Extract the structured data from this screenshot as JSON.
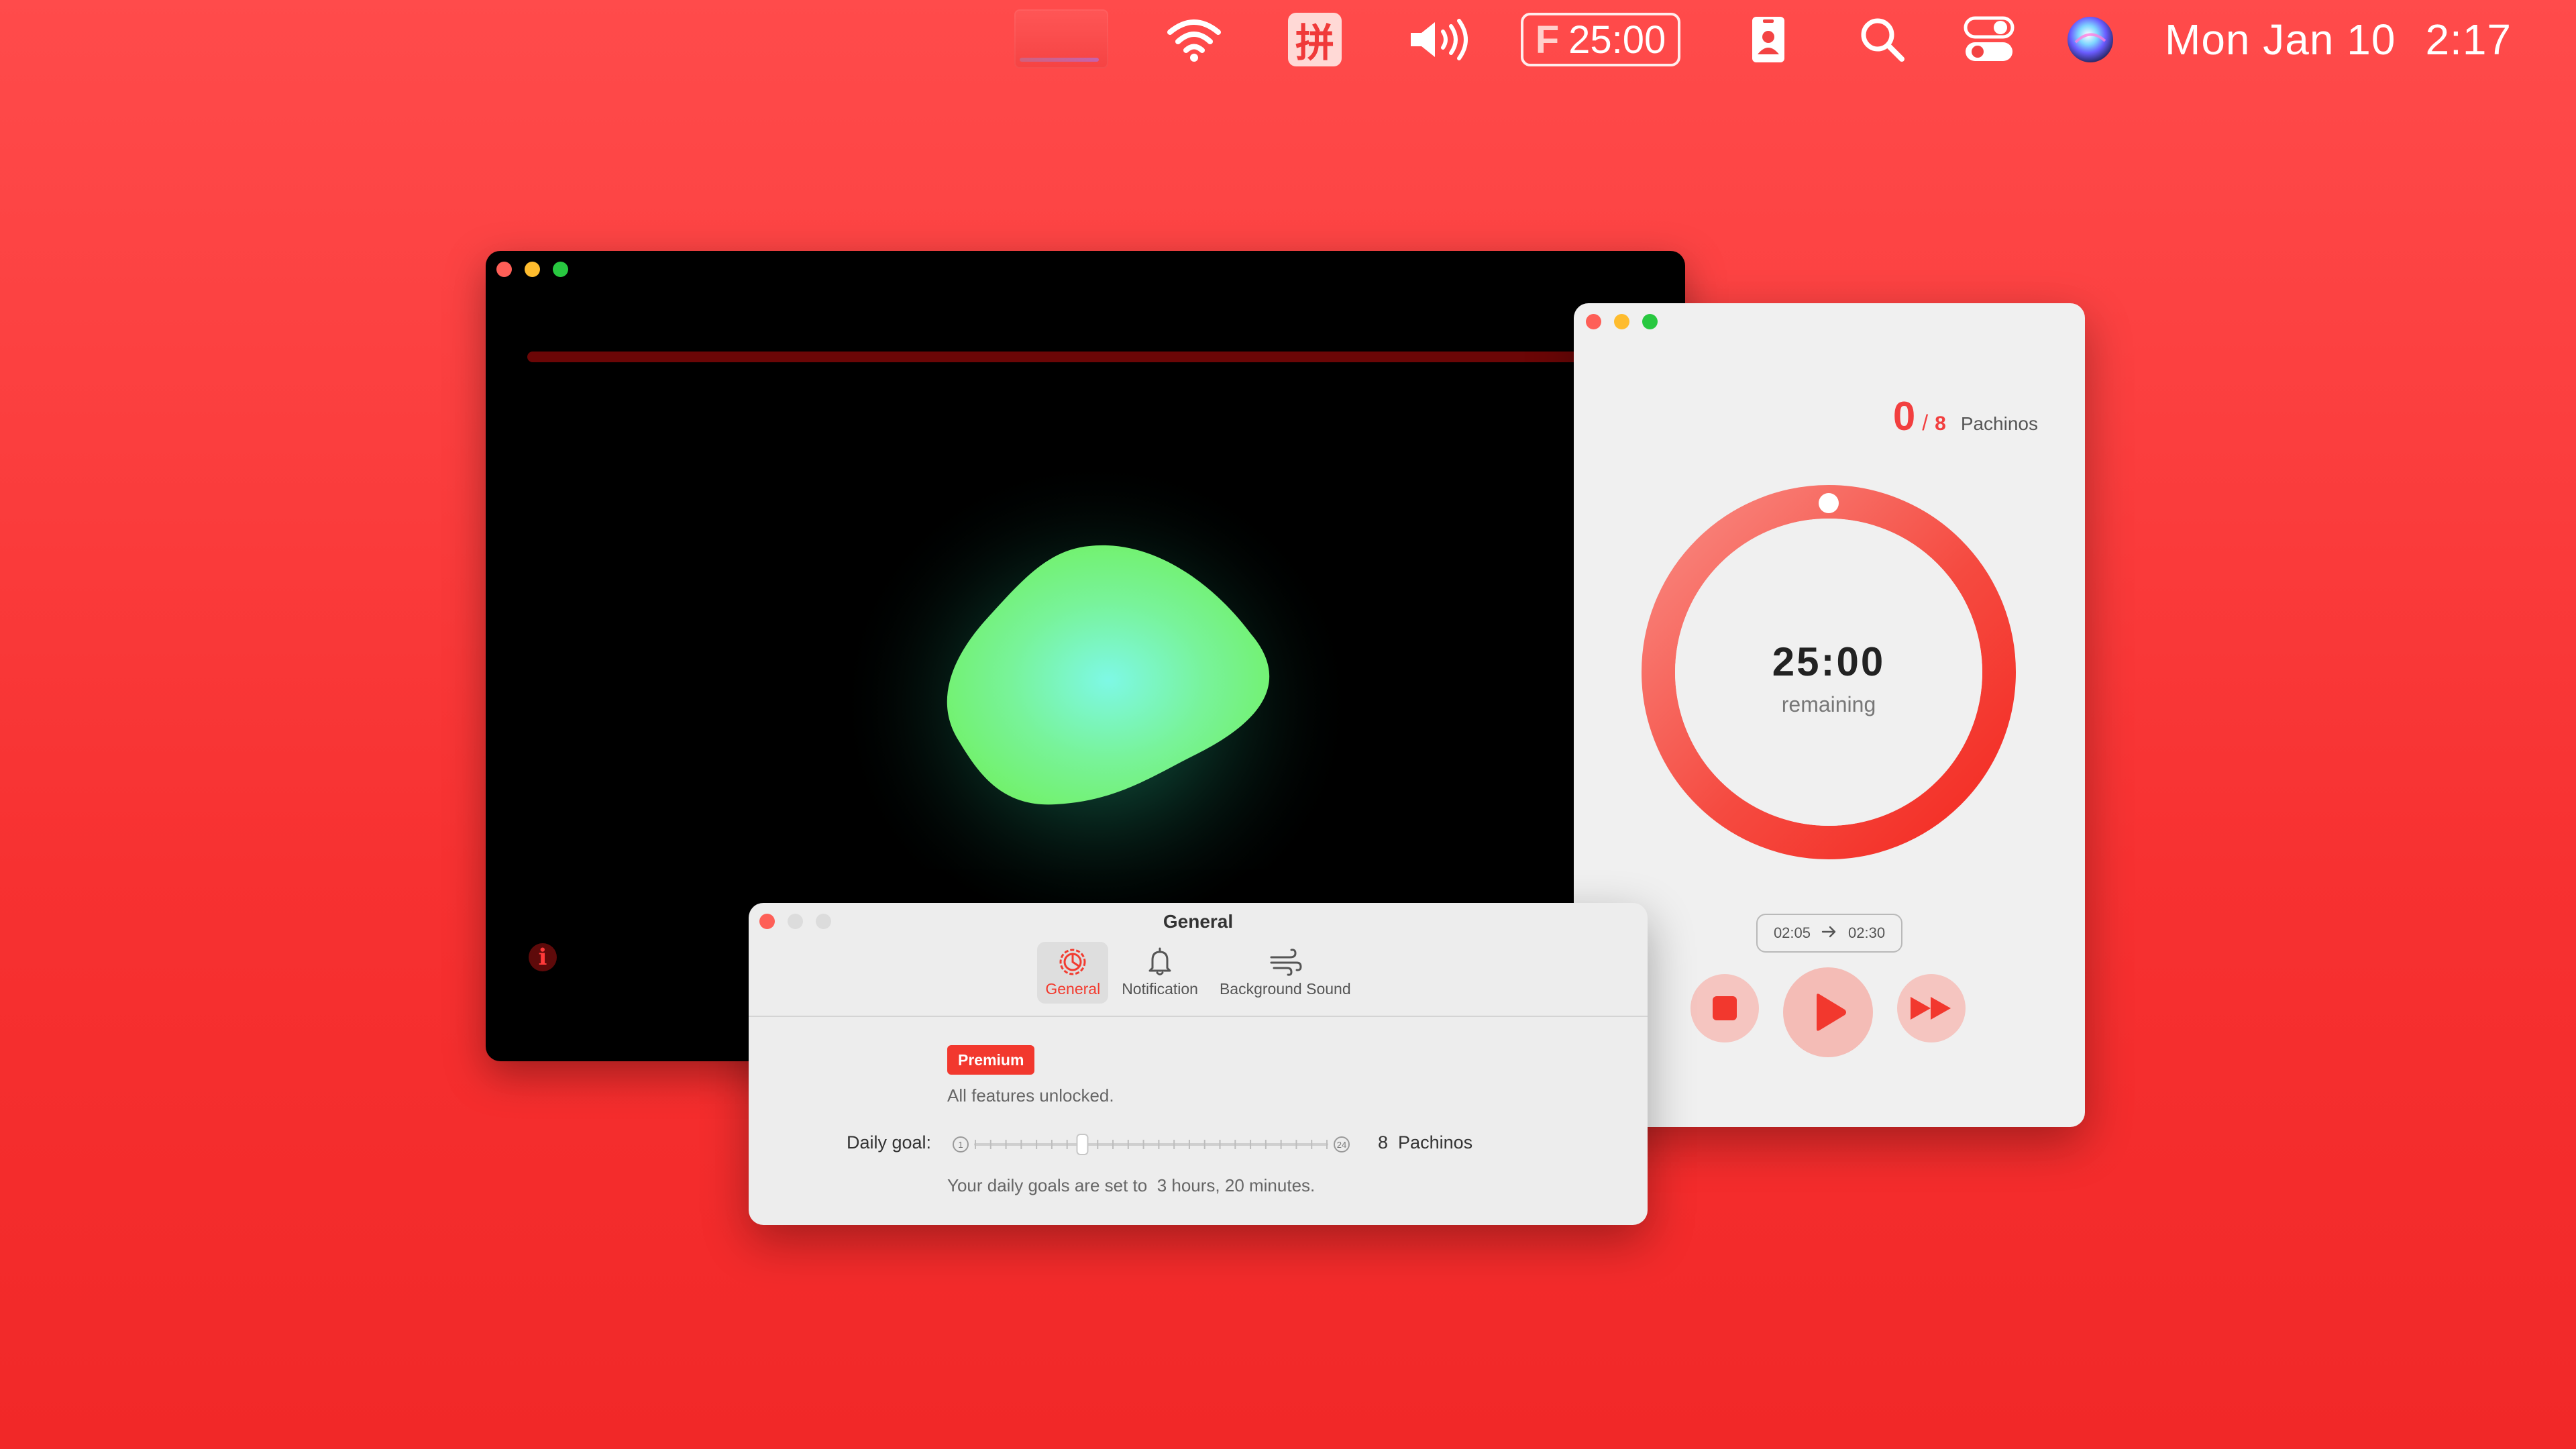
{
  "menubar": {
    "icons": [
      "screen-thumbnail",
      "wifi-icon",
      "pinyin-ime-icon",
      "volume-icon",
      "focus-timer",
      "contact-card-icon",
      "search-icon",
      "control-center-icon",
      "siri-icon"
    ],
    "ime_char": "拼",
    "timer_prefix": "F",
    "timer_value": "25:00",
    "date": "Mon Jan 10",
    "time": "2:17"
  },
  "timer_window": {
    "completed": "0",
    "separator": "/",
    "goal": "8",
    "unit": "Pachinos",
    "remaining_time": "25:00",
    "remaining_label": "remaining",
    "range_start": "02:05",
    "range_end": "02:30",
    "progress_fraction": 0,
    "accent": "#f23f3f"
  },
  "settings_window": {
    "title": "General",
    "tabs": [
      {
        "label": "General",
        "icon": "gear-icon",
        "active": true
      },
      {
        "label": "Notification",
        "icon": "bell-icon",
        "active": false
      },
      {
        "label": "Background Sound",
        "icon": "wind-icon",
        "active": false
      }
    ],
    "premium_badge": "Premium",
    "unlocked_text": "All features unlocked.",
    "daily_goal_label": "Daily goal:",
    "slider_min": "1",
    "slider_max": "24",
    "slider_value": 8,
    "goal_value": "8",
    "goal_unit": "Pachinos",
    "goal_note_prefix": "Your daily goals are set to",
    "goal_note_value": "3 hours, 20 minutes."
  },
  "colors": {
    "background": "#f73131",
    "accent": "#f2382e",
    "blob_inner": "#7ef8e5",
    "blob_outer": "#72f16b"
  }
}
